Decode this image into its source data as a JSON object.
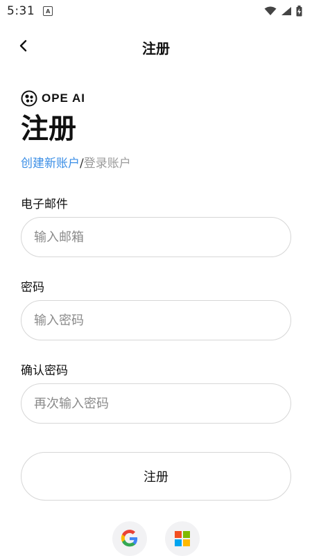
{
  "status_bar": {
    "time": "5:31",
    "notification_icon_letter": "A"
  },
  "top_bar": {
    "title": "注册"
  },
  "logo": {
    "text": "OPE AI"
  },
  "heading": "注册",
  "mode_switch": {
    "create": "创建新账户",
    "separator": "/",
    "login": "登录账户"
  },
  "form": {
    "email": {
      "label": "电子邮件",
      "placeholder": "输入邮箱",
      "value": ""
    },
    "password": {
      "label": "密码",
      "placeholder": "输入密码",
      "value": ""
    },
    "confirm_password": {
      "label": "确认密码",
      "placeholder": "再次输入密码",
      "value": ""
    },
    "submit_label": "注册"
  },
  "social": {
    "google_icon": "google-icon",
    "microsoft_icon": "microsoft-icon"
  },
  "colors": {
    "accent": "#3a8ee6",
    "muted": "#9a9a9a",
    "border": "#d6d6d6"
  }
}
